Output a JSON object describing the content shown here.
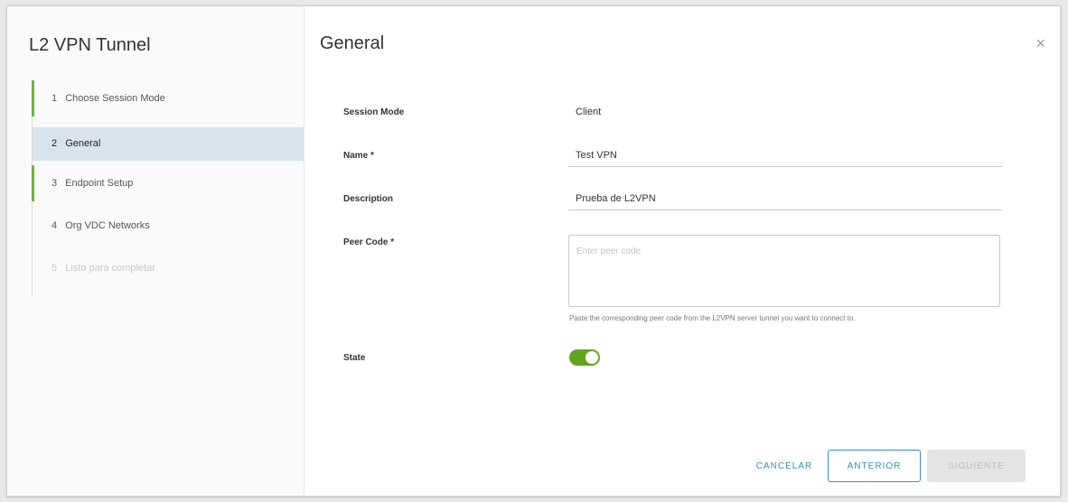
{
  "wizard": {
    "title": "L2 VPN Tunnel",
    "steps": [
      {
        "num": "1",
        "label": "Choose Session Mode",
        "state": "done"
      },
      {
        "num": "2",
        "label": "General",
        "state": "active"
      },
      {
        "num": "3",
        "label": "Endpoint Setup",
        "state": "done"
      },
      {
        "num": "4",
        "label": "Org VDC Networks",
        "state": "pending"
      },
      {
        "num": "5",
        "label": "Listo para completar",
        "state": "disabled"
      }
    ]
  },
  "page": {
    "title": "General",
    "close_glyph": "×"
  },
  "form": {
    "session_mode": {
      "label": "Session Mode",
      "value": "Client"
    },
    "name": {
      "label": "Name *",
      "value": "Test VPN"
    },
    "description": {
      "label": "Description",
      "value": "Prueba de L2VPN"
    },
    "peer_code": {
      "label": "Peer Code *",
      "placeholder": "Enter peer code",
      "helper": "Paste the corresponding peer code from the L2VPN server tunnel you want to connect to."
    },
    "state": {
      "label": "State",
      "on": true
    }
  },
  "buttons": {
    "cancel": "CANCELAR",
    "previous": "ANTERIOR",
    "next": "SIGUIENTE"
  },
  "colors": {
    "accent": "#3a8cc0",
    "step_done": "#6db33f",
    "toggle_on": "#62a420",
    "active_step_bg": "#d8e3ec"
  }
}
